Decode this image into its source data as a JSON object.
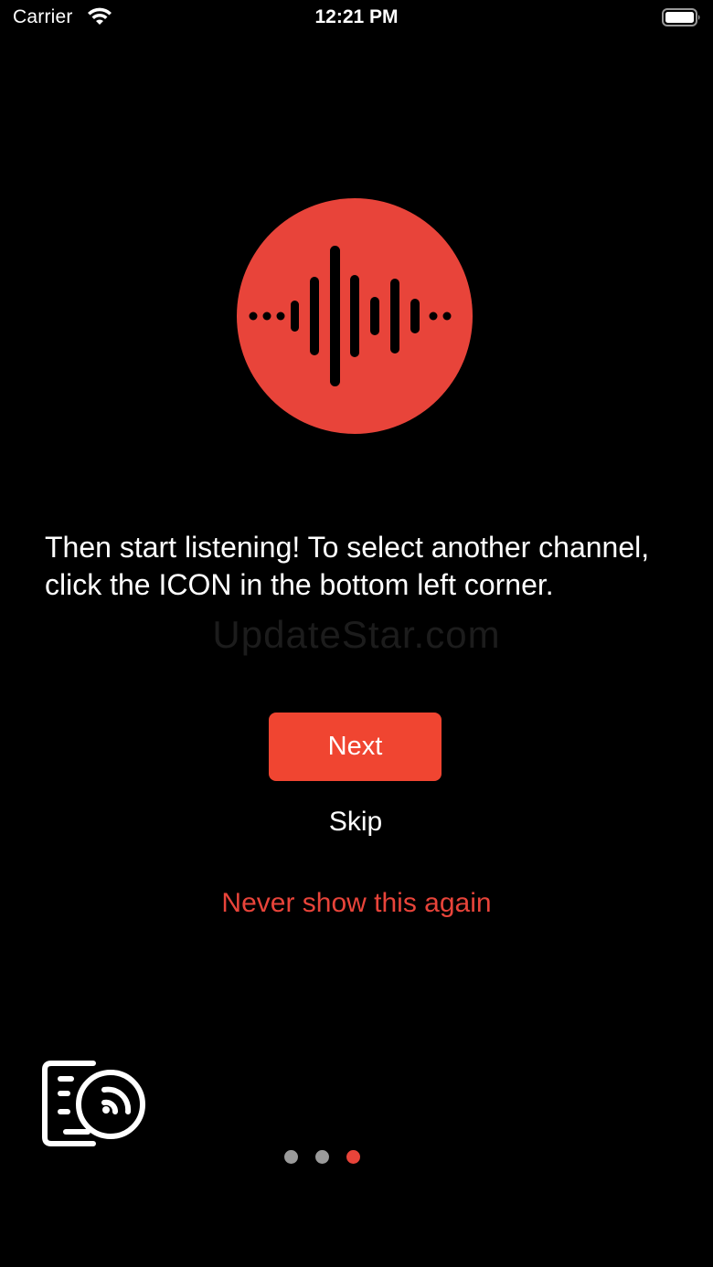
{
  "status_bar": {
    "carrier": "Carrier",
    "time": "12:21 PM"
  },
  "hero": {
    "icon": "sound-wave-icon",
    "circle_color": "#e8443a"
  },
  "onboarding": {
    "message": "Then start listening! To select another channel, click the ICON in the bottom left corner.",
    "watermark": "UpdateStar.com"
  },
  "actions": {
    "next_label": "Next",
    "skip_label": "Skip",
    "never_label": "Never show this again"
  },
  "channel_button": {
    "icon": "device-radio-icon"
  },
  "pagination": {
    "total_pages": 3,
    "current_page": 3,
    "active_color": "#e8443a",
    "inactive_color": "#9a9a9a"
  },
  "colors": {
    "background": "#000000",
    "accent": "#f04531",
    "text": "#ffffff"
  }
}
